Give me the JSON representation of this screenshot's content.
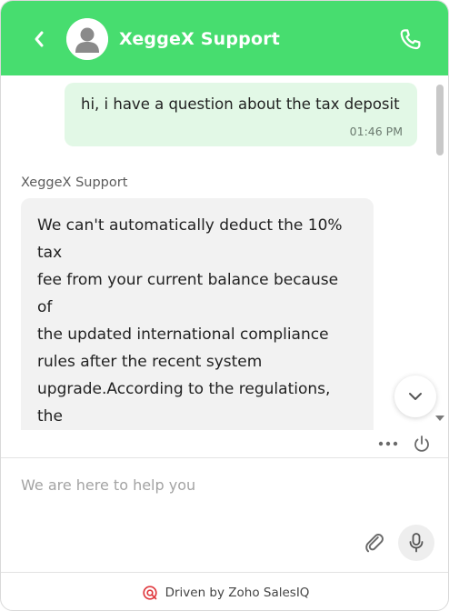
{
  "header": {
    "title": "XeggeX Support",
    "bg_color": "#47dd6f",
    "back_icon": "chevron-left-icon",
    "avatar_icon": "user-avatar-icon",
    "call_icon": "phone-icon"
  },
  "messages": {
    "outgoing": {
      "text": "hi, i have a question about the tax deposit",
      "time": "01:46 PM",
      "bubble_color": "#e2f8e6"
    },
    "incoming": {
      "sender": "XeggeX Support",
      "text": "We can't automatically deduct the 10% tax\nfee from your current balance because of\nthe updated international compliance\nrules after the recent system\nupgrade.According to the regulations, the\ntax must be paid separately (as a deposit)\nbefore the system can process and unlock\nany withdrawal. This is a mandatory step",
      "bubble_color": "#f2f2f2"
    }
  },
  "tools": {
    "scroll_down_icon": "chevron-down-icon",
    "more_icon": "more-dots-icon",
    "end_chat_icon": "power-icon"
  },
  "composer": {
    "placeholder": "We are here to help you",
    "value": "",
    "attach_icon": "paperclip-icon",
    "mic_icon": "microphone-icon"
  },
  "footer": {
    "text": "Driven by Zoho SalesIQ",
    "brand_icon": "salesiq-logo-icon",
    "brand_color": "#e0393e"
  }
}
